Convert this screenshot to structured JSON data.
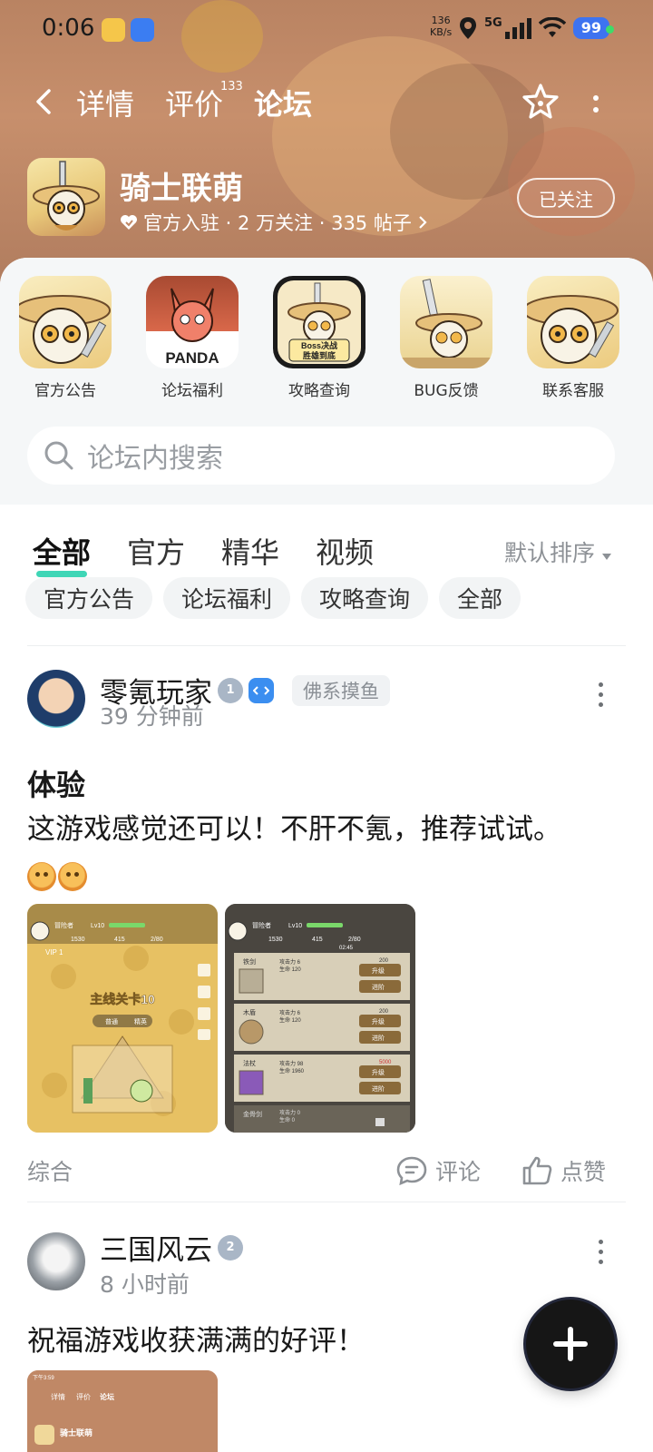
{
  "status_bar": {
    "time": "0:06",
    "net_speed_value": "136",
    "net_speed_unit": "KB/s",
    "network": "5G",
    "battery": "99"
  },
  "nav": {
    "tabs": [
      {
        "label": "详情"
      },
      {
        "label": "评价",
        "count": "133"
      },
      {
        "label": "论坛",
        "active": true
      }
    ]
  },
  "game": {
    "name": "骑士联萌",
    "meta": "官方入驻 · 2 万关注 · 335 帖子",
    "follow_label": "已关注"
  },
  "quick_links": [
    {
      "label": "官方公告",
      "icon": "panda-knight-icon"
    },
    {
      "label": "论坛福利",
      "icon": "panda-dragon-icon",
      "badge_text": "PANDA"
    },
    {
      "label": "攻略查询",
      "icon": "boss-guide-icon",
      "badge_text": "Boss决战 胜雄到底"
    },
    {
      "label": "BUG反馈",
      "icon": "panda-sword-icon"
    },
    {
      "label": "联系客服",
      "icon": "panda-knight-icon"
    }
  ],
  "search": {
    "placeholder": "论坛内搜索"
  },
  "filter_tabs": [
    {
      "label": "全部",
      "active": true
    },
    {
      "label": "官方"
    },
    {
      "label": "精华"
    },
    {
      "label": "视频"
    }
  ],
  "sort_label": "默认排序",
  "chips": [
    "官方公告",
    "论坛福利",
    "攻略查询",
    "全部"
  ],
  "posts": [
    {
      "author": "零氪玩家",
      "badge_level": "1",
      "tag": "佛系摸鱼",
      "time": "39 分钟前",
      "title": "体验",
      "body": "这游戏感觉还可以！不肝不氪，推荐试试。",
      "category": "综合",
      "comment_label": "评论",
      "like_label": "点赞",
      "screenshot1": {
        "level_title": "主线关卡10",
        "tab_normal": "普通",
        "tab_elite": "精英",
        "player": "冒险者",
        "lv": "Lv10",
        "s1": "1530",
        "s2": "415",
        "s3": "2/80",
        "vip": "VIP 1"
      },
      "screenshot2": {
        "player": "冒险者",
        "lv": "Lv10",
        "s1": "1530",
        "s2": "415",
        "s3": "2/80",
        "timer": "02:45",
        "rows": [
          {
            "name": "铁剑",
            "stat1": "攻击力 6",
            "stat2": "生命 120",
            "cost": "200",
            "btn1": "升级",
            "btn2": "进阶"
          },
          {
            "name": "木盾",
            "stat1": "攻击力 6",
            "stat2": "生命 120",
            "cost": "200",
            "btn1": "升级",
            "btn2": "进阶"
          },
          {
            "name": "法杖",
            "stat1": "攻击力 98",
            "stat2": "生命 1960",
            "cost": "5000",
            "btn1": "升级",
            "btn2": "进阶"
          },
          {
            "name": "金骨剑",
            "stat1": "攻击力 0",
            "stat2": "生命 0"
          }
        ]
      }
    },
    {
      "author": "三国风云",
      "badge_level": "2",
      "time": "8 小时前",
      "body": "祝福游戏收获满满的好评！",
      "thumb": {
        "time": "下午3:59",
        "tabs": [
          "详情",
          "评价",
          "论坛"
        ],
        "name": "骑士联萌"
      }
    }
  ],
  "colors": {
    "accent": "#3fd6b6",
    "hero_bg": "#c08866",
    "panel_bg": "#f5f7f8",
    "muted_text": "#8d9196"
  }
}
